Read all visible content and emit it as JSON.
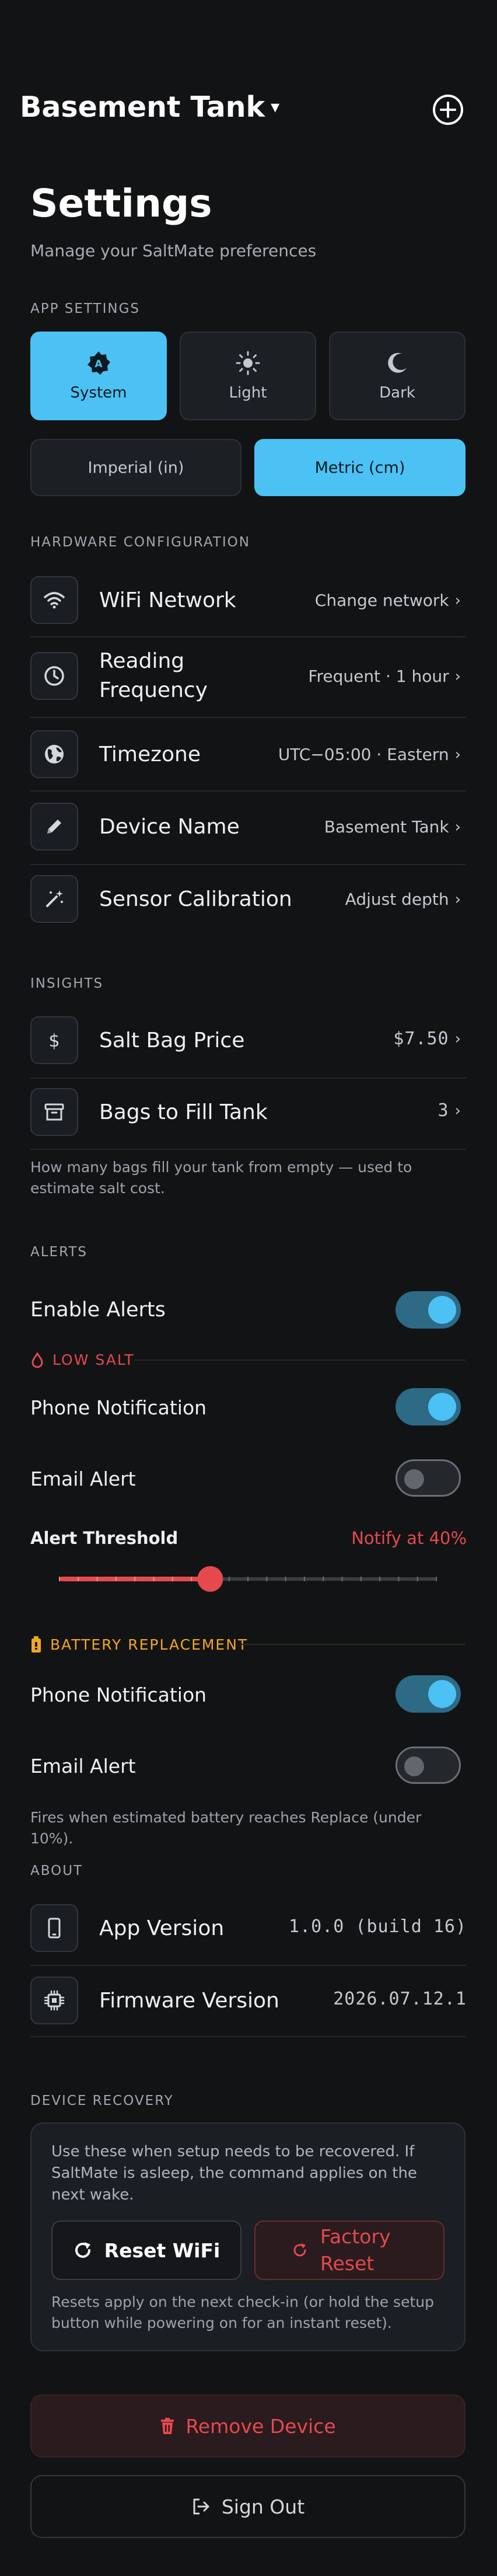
{
  "header": {
    "device_name": "Basement Tank"
  },
  "page": {
    "title": "Settings",
    "subtitle": "Manage your SaltMate preferences"
  },
  "app_settings": {
    "label": "APP SETTINGS",
    "themes": [
      {
        "label": "System",
        "icon": "auto-theme-icon",
        "selected": true
      },
      {
        "label": "Light",
        "icon": "sun-icon",
        "selected": false
      },
      {
        "label": "Dark",
        "icon": "moon-icon",
        "selected": false
      }
    ],
    "units": [
      {
        "label": "Imperial (in)",
        "selected": false
      },
      {
        "label": "Metric (cm)",
        "selected": true
      }
    ]
  },
  "hardware": {
    "label": "HARDWARE CONFIGURATION",
    "rows": [
      {
        "label": "WiFi Network",
        "value": "Change network",
        "icon": "wifi-icon"
      },
      {
        "label": "Reading Frequency",
        "value": "Frequent · 1 hour",
        "icon": "clock-icon"
      },
      {
        "label": "Timezone",
        "value": "UTC−05:00 · Eastern",
        "icon": "globe-icon"
      },
      {
        "label": "Device Name",
        "value": "Basement Tank",
        "icon": "pencil-icon"
      },
      {
        "label": "Sensor Calibration",
        "value": "Adjust depth",
        "icon": "wand-icon"
      }
    ]
  },
  "insights": {
    "label": "INSIGHTS",
    "rows": [
      {
        "label": "Salt Bag Price",
        "value": "$7.50",
        "icon": "dollar-icon"
      },
      {
        "label": "Bags to Fill Tank",
        "value": "3",
        "icon": "archive-icon"
      }
    ],
    "help": "How many bags fill your tank from empty — used to estimate salt cost."
  },
  "alerts": {
    "label": "ALERTS",
    "enable_label": "Enable Alerts",
    "enabled": true,
    "low_salt": {
      "label": "LOW SALT",
      "phone_label": "Phone Notification",
      "phone_on": true,
      "email_label": "Email Alert",
      "email_on": false,
      "threshold_label": "Alert Threshold",
      "threshold_value": "Notify at 40%",
      "threshold_fraction": 0.4
    },
    "battery": {
      "label": "BATTERY REPLACEMENT",
      "phone_label": "Phone Notification",
      "phone_on": true,
      "email_label": "Email Alert",
      "email_on": false,
      "help": "Fires when estimated battery reaches Replace (under 10%)."
    }
  },
  "about": {
    "label": "ABOUT",
    "rows": [
      {
        "label": "App Version",
        "value": "1.0.0 (build 16)",
        "icon": "phone-icon"
      },
      {
        "label": "Firmware Version",
        "value": "2026.07.12.1",
        "icon": "chip-icon"
      }
    ]
  },
  "recovery": {
    "label": "DEVICE RECOVERY",
    "description": "Use these when setup needs to be recovered. If SaltMate is asleep, the command applies on the next wake.",
    "reset_wifi": "Reset WiFi",
    "factory_reset": "Factory Reset",
    "help": "Resets apply on the next check-in (or hold the setup button while powering on for an instant reset)."
  },
  "actions": {
    "remove_device": "Remove Device",
    "sign_out": "Sign Out"
  },
  "colors": {
    "accent": "#4cc1f4",
    "danger": "#e5484d",
    "warning": "#f5a524",
    "background": "#111315"
  }
}
